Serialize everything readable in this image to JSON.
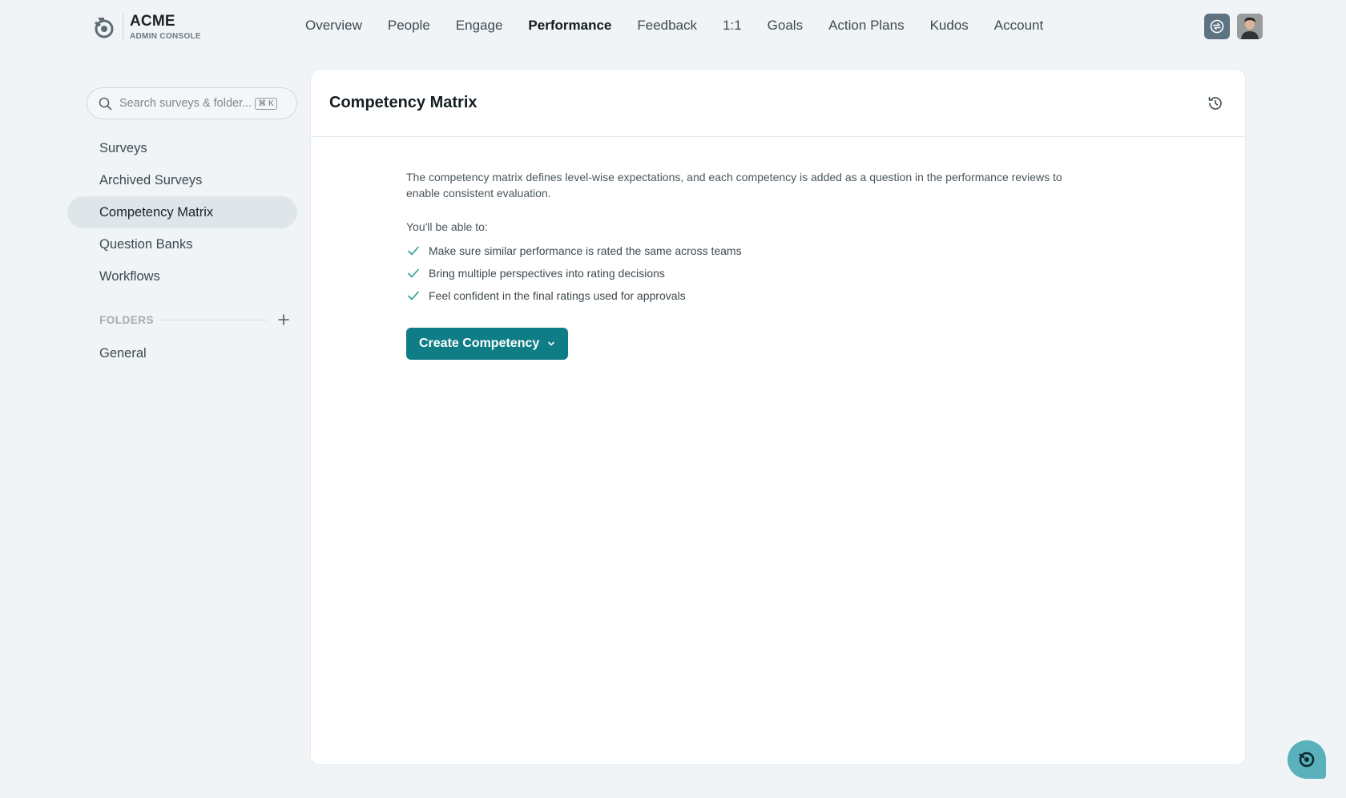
{
  "brand": {
    "name": "ACME",
    "subtitle": "ADMIN CONSOLE",
    "logo_icon": "acme-logo-icon"
  },
  "nav": {
    "items": [
      {
        "label": "Overview",
        "active": false
      },
      {
        "label": "People",
        "active": false
      },
      {
        "label": "Engage",
        "active": false
      },
      {
        "label": "Performance",
        "active": true
      },
      {
        "label": "Feedback",
        "active": false
      },
      {
        "label": "1:1",
        "active": false
      },
      {
        "label": "Goals",
        "active": false
      },
      {
        "label": "Action Plans",
        "active": false
      },
      {
        "label": "Kudos",
        "active": false
      },
      {
        "label": "Account",
        "active": false
      }
    ]
  },
  "sidebar": {
    "search": {
      "placeholder": "Search surveys & folder...",
      "shortcut": "⌘ K"
    },
    "items": [
      {
        "label": "Surveys",
        "active": false
      },
      {
        "label": "Archived Surveys",
        "active": false
      },
      {
        "label": "Competency Matrix",
        "active": true
      },
      {
        "label": "Question Banks",
        "active": false
      },
      {
        "label": "Workflows",
        "active": false
      }
    ],
    "folders_label": "FOLDERS",
    "folders": [
      {
        "label": "General"
      }
    ]
  },
  "main": {
    "title": "Competency Matrix",
    "description": "The competency matrix defines level-wise expectations, and each competency is added as a question in the performance reviews to enable consistent evaluation.",
    "able_label": "You'll be able to:",
    "benefits": [
      "Make sure similar performance is rated the same across teams",
      "Bring multiple perspectives into rating decisions",
      "Feel confident in the final ratings used for approvals"
    ],
    "create_button": "Create Competency"
  },
  "colors": {
    "accent": "#0f7d86",
    "background": "#f0f4f6",
    "check": "#2a9d8f",
    "chat_fab": "#5ab0bb"
  }
}
